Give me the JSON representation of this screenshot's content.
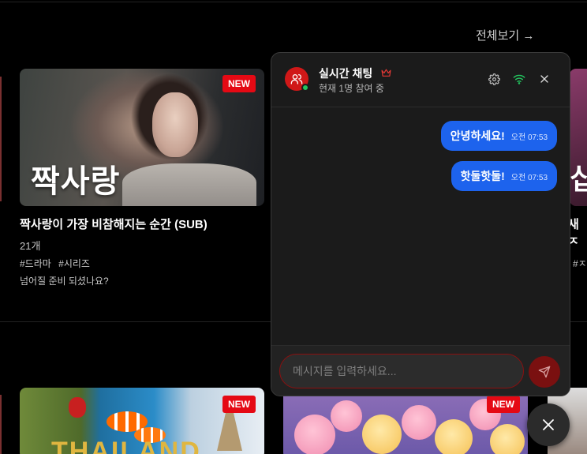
{
  "section": {
    "see_all": "전체보기 →"
  },
  "cards": [
    {
      "badge": "NEW",
      "thumb_text": "짝사랑",
      "title": "짝사랑이 가장 비참해지는 순간 (SUB)",
      "count": "21개",
      "tags": [
        "#드라마",
        "#시리즈"
      ],
      "description": "넘어질 준비 되셨나요?"
    }
  ],
  "right_partial": {
    "glyph": "십",
    "title": "새 ㅈ",
    "tag": "#ㅈ"
  },
  "bottom_cards": [
    {
      "badge": "NEW",
      "thumb_text": "THAILAND"
    },
    {
      "badge": "NEW"
    }
  ],
  "chat": {
    "title": "실시간 채팅",
    "subtitle": "현재 1명 참여 중",
    "messages": [
      {
        "text": "안녕하세요!",
        "time": "오전 07:53"
      },
      {
        "text": "핫둘핫둘!",
        "time": "오전 07:53"
      }
    ],
    "input_placeholder": "메시지를 입력하세요..."
  },
  "colors": {
    "brand_red": "#e50914",
    "bubble_blue": "#1d63ed",
    "online_green": "#22c55e"
  },
  "icons": [
    "users-icon",
    "crown-icon",
    "gear-icon",
    "wifi-icon",
    "close-icon",
    "send-icon"
  ]
}
